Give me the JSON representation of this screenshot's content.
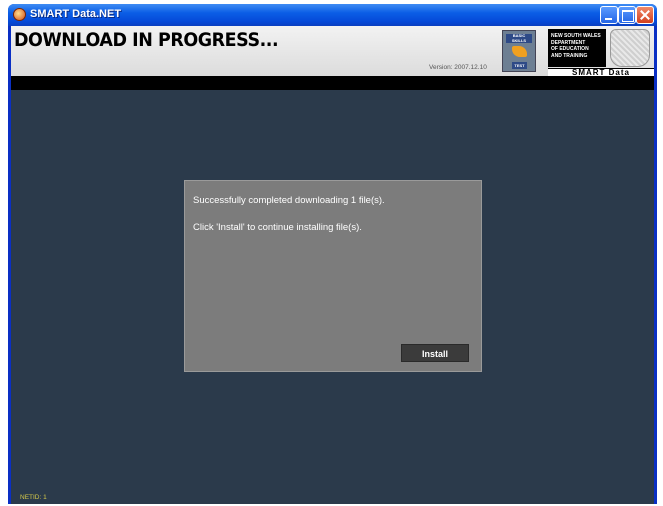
{
  "window": {
    "title": "SMART Data.NET"
  },
  "header": {
    "title": "DOWNLOAD IN PROGRESS...",
    "version": "Version: 2007.12.10",
    "bst_logo_top": "BASIC SKILLS",
    "bst_logo_bottom": "TEST",
    "nsw_lines": [
      "NEW SOUTH WALES",
      "DEPARTMENT",
      "OF EDUCATION",
      "AND TRAINING"
    ],
    "brand": "SMART Data"
  },
  "dialog": {
    "message_line1": "Successfully completed downloading 1 file(s).",
    "message_line2": "Click 'Install' to continue installing file(s).",
    "install_label": "Install"
  },
  "footer": {
    "netid": "NETID: 1"
  },
  "colors": {
    "titlebar": "#0549d8",
    "background": "#2b3a4b",
    "dialog": "#7c7c7c",
    "button": "#3b3b3b",
    "netid_text": "#d4c84a"
  },
  "icons": {
    "app": "smart-data-app-icon",
    "minimize": "minimize-icon",
    "maximize": "maximize-icon",
    "close": "close-icon",
    "bst_logo": "basic-skills-test-logo",
    "crest": "nsw-crest-icon"
  }
}
